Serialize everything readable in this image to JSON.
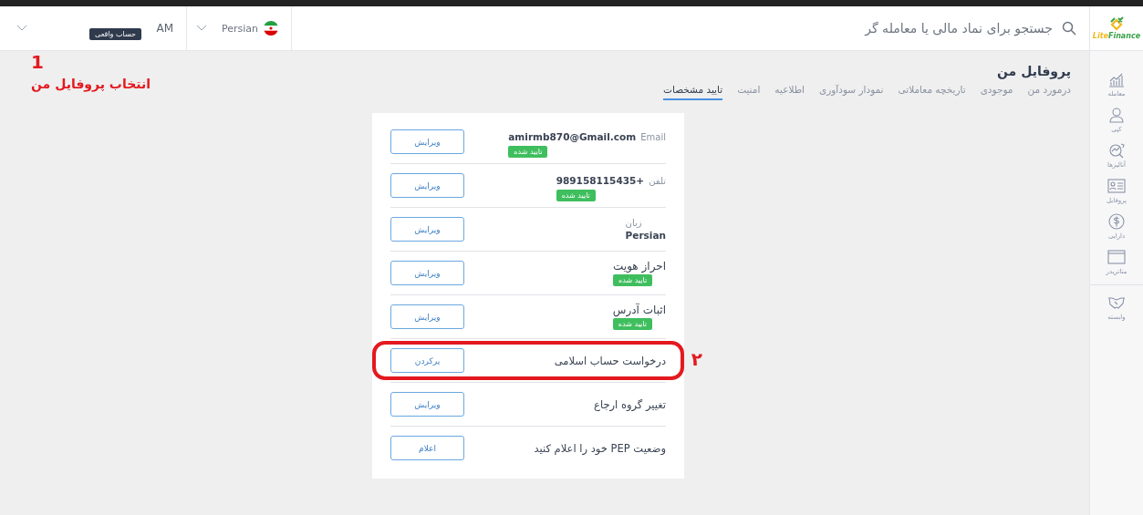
{
  "logo": {
    "part_1": "Lite",
    "part_2": "Finance"
  },
  "search": {
    "placeholder": "جستجو برای نماد مالی یا معامله گر"
  },
  "language": {
    "label": "Persian"
  },
  "account": {
    "initials": "AM",
    "type": "حساب واقعی"
  },
  "sidebar": {
    "items": [
      {
        "label": "معامله"
      },
      {
        "label": "کپی"
      },
      {
        "label": "آنالیزها"
      },
      {
        "label": "پروفایل"
      },
      {
        "label": "دارایی"
      },
      {
        "label": "متاتریدر"
      },
      {
        "label": "وابسته"
      }
    ]
  },
  "page": {
    "title": "پروفایل من"
  },
  "tabs": [
    {
      "label": "درمورد من",
      "selected": false
    },
    {
      "label": "موجودی",
      "selected": false
    },
    {
      "label": "تاریخچه معاملاتی",
      "selected": false
    },
    {
      "label": "نمودار سودآوری",
      "selected": false
    },
    {
      "label": "اطلاعیه",
      "selected": false
    },
    {
      "label": "امنیت",
      "selected": false
    },
    {
      "label": "تایید مشخصات",
      "selected": true
    }
  ],
  "rows": [
    {
      "kind": "inline",
      "label": "Email",
      "value": "amirmb870@Gmail.com",
      "badge": "تایید شده",
      "button": "ویرایش",
      "highlighted": false
    },
    {
      "kind": "inline",
      "label": "تلفن",
      "value": "989158115435+",
      "badge": "تایید شده",
      "button": "ویرایش",
      "highlighted": false
    },
    {
      "kind": "stacked",
      "label": "زبان",
      "value": "Persian",
      "button": "ویرایش",
      "highlighted": false
    },
    {
      "kind": "title",
      "label": "احراز هویت",
      "badge": "تایید شده",
      "button": "ویرایش",
      "highlighted": false
    },
    {
      "kind": "title",
      "label": "اثبات آدرس",
      "badge": "تایید شده",
      "button": "ویرایش",
      "highlighted": false
    },
    {
      "kind": "plain",
      "label": "درخواست حساب اسلامی",
      "button": "پرکردن",
      "highlighted": true
    },
    {
      "kind": "plain",
      "label": "تغییر گروه ارجاع",
      "button": "ویرایش",
      "highlighted": false
    },
    {
      "kind": "plain",
      "label": "وضعیت PEP خود را اعلام کنید",
      "button": "اعلام",
      "highlighted": false
    }
  ],
  "annotations": [
    {
      "number": "1",
      "text": "انتخاب پروفایل من"
    },
    {
      "number": "۲"
    }
  ]
}
